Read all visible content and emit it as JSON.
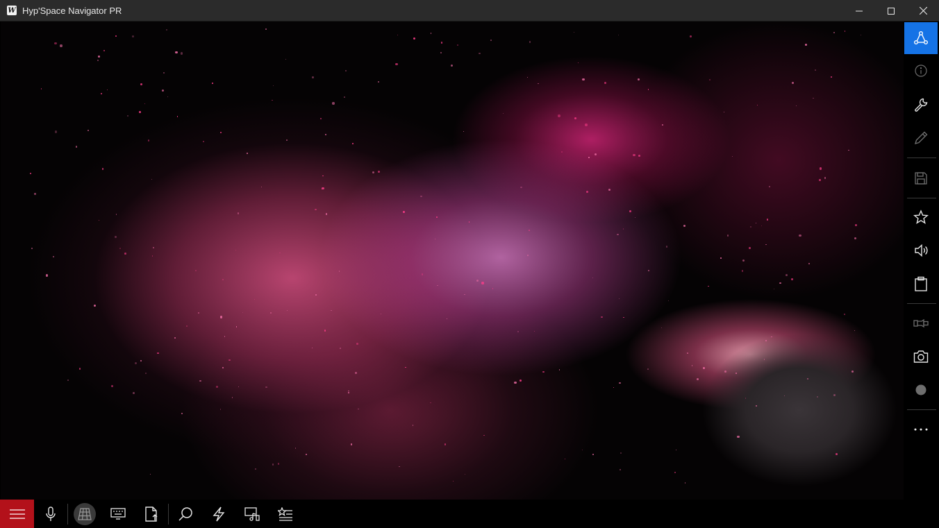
{
  "window": {
    "title": "Hyp'Space Navigator PR",
    "logo_letter": "W"
  },
  "titlebar_controls": [
    "minimize-icon",
    "maximize-icon",
    "close-icon"
  ],
  "sidebar": {
    "accent": "#1573e6",
    "items": [
      {
        "icon": "share-icon",
        "state": "active"
      },
      {
        "icon": "info-icon",
        "state": "disabled"
      },
      {
        "icon": "wrench-icon",
        "state": "enabled"
      },
      {
        "icon": "pencil-icon",
        "state": "disabled"
      },
      {
        "icon": "save-icon",
        "state": "disabled"
      },
      {
        "icon": "star-icon",
        "state": "enabled"
      },
      {
        "icon": "speaker-icon",
        "state": "enabled"
      },
      {
        "icon": "clipboard-icon",
        "state": "enabled"
      },
      {
        "icon": "flashlight-icon",
        "state": "disabled"
      },
      {
        "icon": "camera-icon",
        "state": "enabled"
      },
      {
        "icon": "record-icon",
        "state": "disabled"
      },
      {
        "icon": "more-icon",
        "state": "enabled"
      }
    ]
  },
  "toolbar": {
    "menu_color": "#b3111a",
    "items": [
      "hamburger-icon",
      "microphone-icon",
      "globe-icon",
      "keyboard-icon",
      "file-upload-icon",
      "search-icon",
      "lightning-icon",
      "media-icon",
      "favorites-list-icon"
    ]
  }
}
